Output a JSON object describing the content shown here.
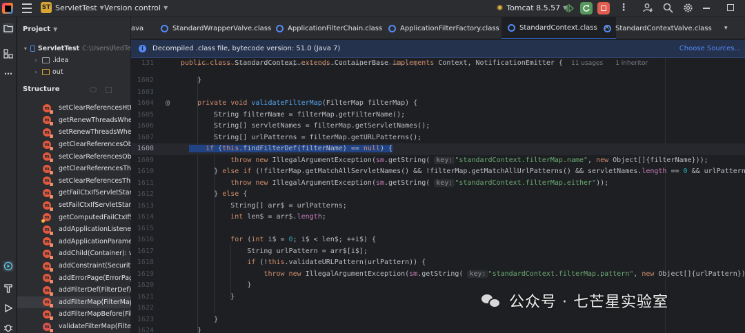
{
  "titlebar": {
    "project_badge": "ST",
    "project_name": "ServletTest",
    "vcs_label": "Version control",
    "run_config": "Tomcat 8.5.57",
    "colors": {
      "run_active": "#57965c",
      "stop": "#e25c4f",
      "badge": "#d8a534"
    }
  },
  "project_panel": {
    "title": "Project",
    "tree": [
      {
        "label": "ServletTest",
        "path": "C:\\Users\\RedTe"
      },
      {
        "label": ".idea"
      },
      {
        "label": "out"
      }
    ]
  },
  "structure": {
    "title": "Structure",
    "items": [
      {
        "label": "setClearReferencesHttp"
      },
      {
        "label": "getRenewThreadsWhen"
      },
      {
        "label": "setRenewThreadsWhen"
      },
      {
        "label": "getClearReferencesObje"
      },
      {
        "label": "setClearReferencesObje"
      },
      {
        "label": "getClearReferencesThre"
      },
      {
        "label": "setClearReferencesThre"
      },
      {
        "label": "getFailCtxIfServletStartI"
      },
      {
        "label": "setFailCtxIfServletStartF"
      },
      {
        "label": "getComputedFailCtxIfSe"
      },
      {
        "label": "addApplicationListener"
      },
      {
        "label": "addApplicationParamet"
      },
      {
        "label": "addChild(Container): vo"
      },
      {
        "label": "addConstraint(SecurityC"
      },
      {
        "label": "addErrorPage(ErrorPage"
      },
      {
        "label": "addFilterDef(FilterDef):"
      },
      {
        "label": "addFilterMap(FilterMap"
      },
      {
        "label": "addFilterMapBefore(Filt"
      },
      {
        "label": "validateFilterMap(Filter"
      }
    ]
  },
  "tabs": [
    {
      "label": "ava"
    },
    {
      "label": "StandardWrapperValve.class"
    },
    {
      "label": "ApplicationFilterChain.class"
    },
    {
      "label": "ApplicationFilterFactory.class"
    },
    {
      "label": "StandardContext.class"
    },
    {
      "label": "StandardContextValve.class"
    }
  ],
  "banner": {
    "text": "Decompiled .class file, bytecode version: 51.0 (Java 7)",
    "link": "Choose Sources..."
  },
  "editor": {
    "line_numbers": [
      "131",
      "",
      "1602",
      "1603",
      "1604",
      "1605",
      "1606",
      "1607",
      "1608",
      "1609",
      "1610",
      "1611",
      "1612",
      "1613",
      "1614",
      "1615",
      "1616",
      "1617",
      "1618",
      "1619",
      "1620",
      "1621",
      "1622",
      "1623",
      "1624"
    ],
    "usages": "11 usages",
    "inheritors": "1 inheritor",
    "key_hint": "key:",
    "watermark": "公众号 · 七芒星实验室"
  }
}
